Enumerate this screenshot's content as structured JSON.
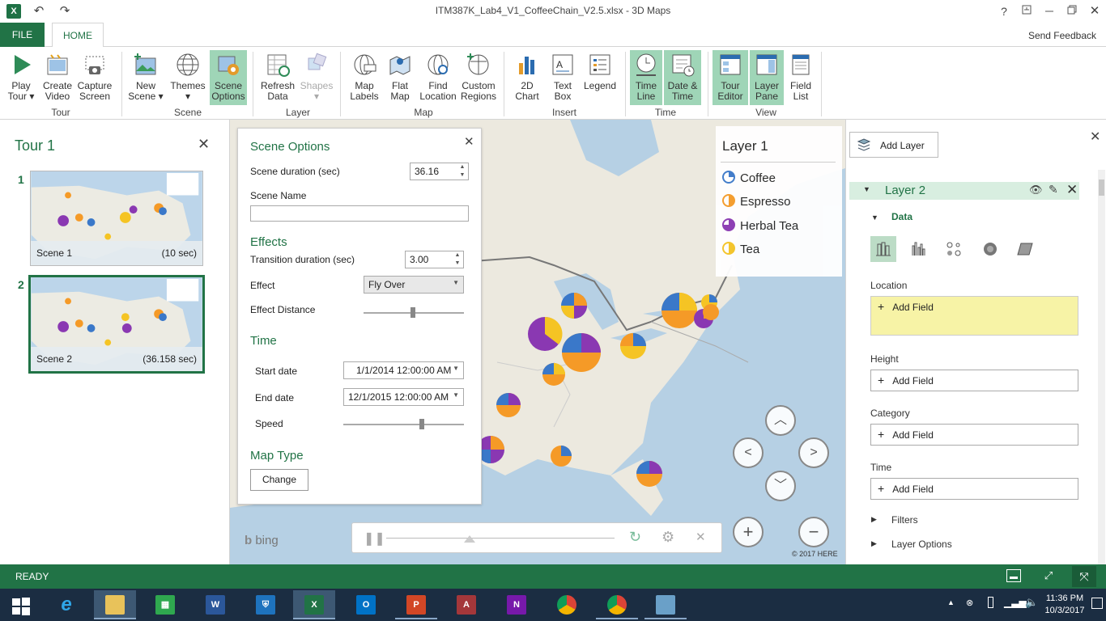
{
  "window": {
    "title": "ITM387K_Lab4_V1_CoffeeChain_V2.5.xlsx - 3D Maps",
    "app_icon": "X",
    "help": "?",
    "controls": [
      "restore-icon",
      "minimize-icon",
      "maximize-icon",
      "close-icon"
    ]
  },
  "ribbon": {
    "file_tab": "FILE",
    "home_tab": "HOME",
    "send_feedback": "Send Feedback",
    "buttons": {
      "play_tour": [
        "Play",
        "Tour ▾"
      ],
      "create_video": [
        "Create",
        "Video"
      ],
      "capture_screen": [
        "Capture",
        "Screen"
      ],
      "new_scene": [
        "New",
        "Scene ▾"
      ],
      "themes": [
        "Themes",
        "▾"
      ],
      "scene_options": [
        "Scene",
        "Options"
      ],
      "refresh_data": [
        "Refresh",
        "Data"
      ],
      "shapes": [
        "Shapes",
        "▾"
      ],
      "map_labels": [
        "Map",
        "Labels"
      ],
      "flat_map": [
        "Flat",
        "Map"
      ],
      "find_location": [
        "Find",
        "Location"
      ],
      "custom_regions": [
        "Custom",
        "Regions"
      ],
      "chart_2d": [
        "2D",
        "Chart"
      ],
      "text_box": [
        "Text",
        "Box"
      ],
      "legend": [
        "Legend",
        ""
      ],
      "time_line": [
        "Time",
        "Line"
      ],
      "date_time": [
        "Date &",
        "Time"
      ],
      "tour_editor": [
        "Tour",
        "Editor"
      ],
      "layer_pane": [
        "Layer",
        "Pane"
      ],
      "field_list": [
        "Field",
        "List"
      ]
    },
    "groups": {
      "tour": "Tour",
      "scene": "Scene",
      "layer": "Layer",
      "map": "Map",
      "insert": "Insert",
      "time": "Time",
      "view": "View"
    }
  },
  "tour_pane": {
    "title": "Tour 1",
    "close": "✕",
    "scenes": [
      {
        "number": "1",
        "name": "Scene 1",
        "duration": "(10 sec)",
        "selected": false
      },
      {
        "number": "2",
        "name": "Scene 2",
        "duration": "(36.158 sec)",
        "selected": true
      }
    ]
  },
  "scene_options": {
    "title": "Scene Options",
    "close": "✕",
    "scene_duration_label": "Scene duration (sec)",
    "scene_duration_value": "36.16",
    "scene_name_label": "Scene Name",
    "scene_name_value": "",
    "effects_heading": "Effects",
    "transition_duration_label": "Transition duration (sec)",
    "transition_duration_value": "3.00",
    "effect_label": "Effect",
    "effect_value": "Fly Over",
    "effect_distance_label": "Effect Distance",
    "effect_distance_level": 0.49,
    "time_heading": "Time",
    "start_date_label": "Start date",
    "start_date_value": "1/1/2014 12:00:00 AM",
    "end_date_label": "End date",
    "end_date_value": "12/1/2015 12:00:00 AM",
    "speed_label": "Speed",
    "speed_level": 0.65,
    "map_type_heading": "Map Type",
    "change_button": "Change"
  },
  "legend": {
    "title": "Layer 1",
    "items": [
      {
        "label": "Coffee",
        "color": "#3a78c9"
      },
      {
        "label": "Espresso",
        "color": "#f59a27"
      },
      {
        "label": "Herbal Tea",
        "color": "#8a38b2"
      },
      {
        "label": "Tea",
        "color": "#f5c424"
      }
    ]
  },
  "map": {
    "bing": "bing",
    "copyright": "© 2017 HERE"
  },
  "layer_pane": {
    "add_layer": "Add Layer",
    "close": "✕",
    "layer_name": "Layer 2",
    "data_heading": "Data",
    "location_label": "Location",
    "height_label": "Height",
    "category_label": "Category",
    "time_label": "Time",
    "add_field": "Add Field",
    "filters": "Filters",
    "layer_options": "Layer Options"
  },
  "status": {
    "text": "READY"
  },
  "taskbar": {
    "time": "11:36 PM",
    "date": "10/3/2017"
  }
}
